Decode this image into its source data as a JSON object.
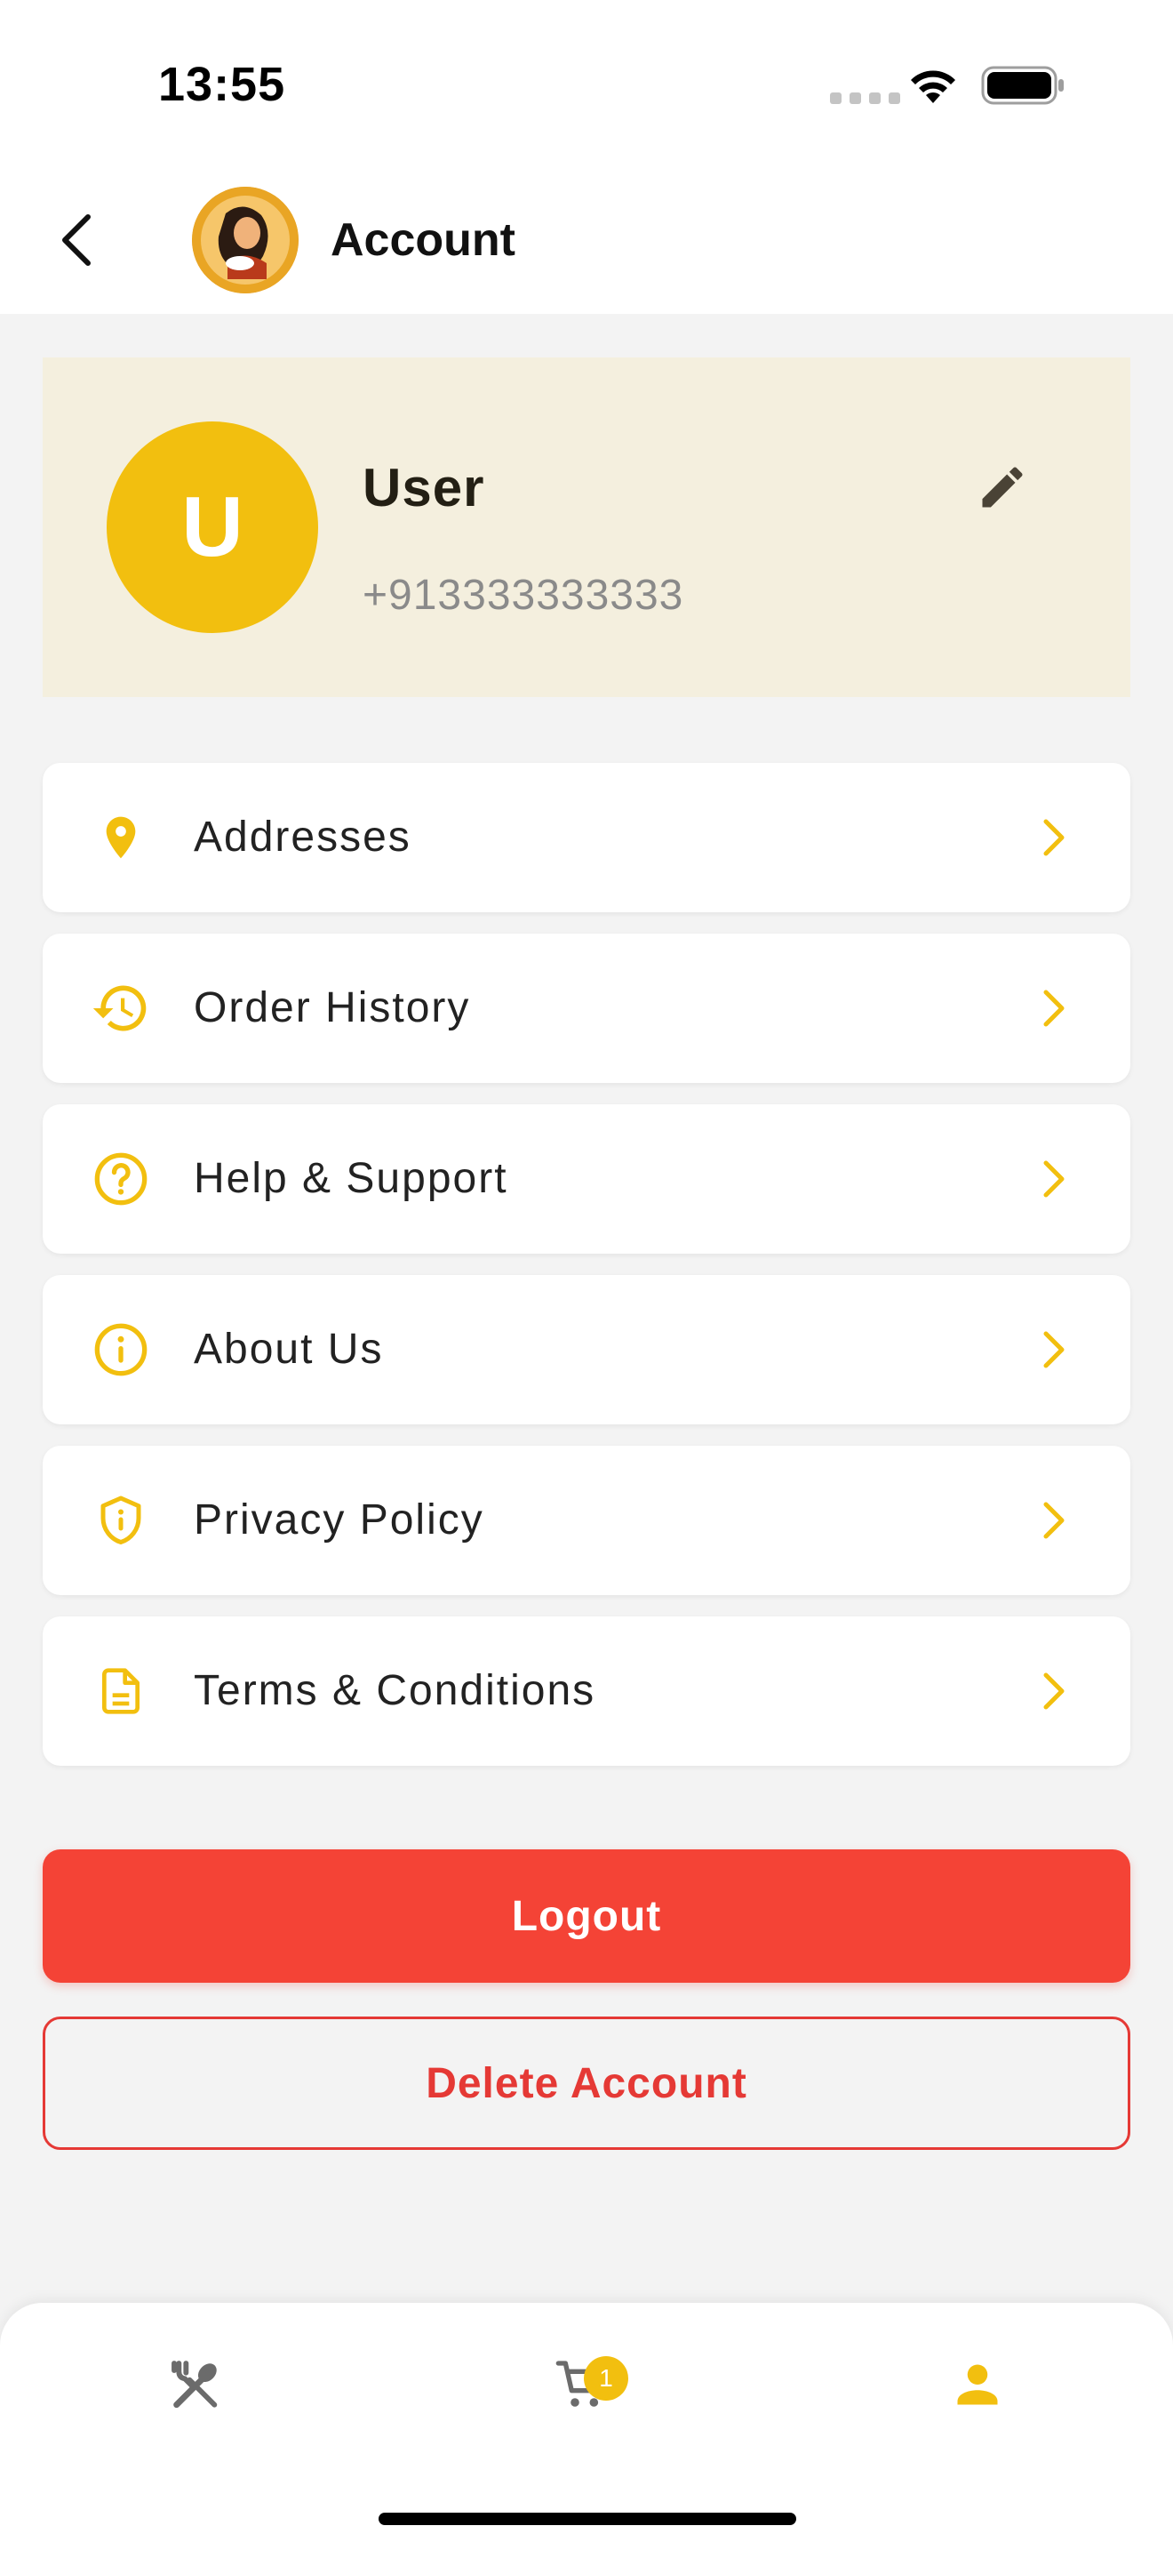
{
  "status_bar": {
    "time": "13:55"
  },
  "header": {
    "title": "Account",
    "back_icon": "chevron-left-icon",
    "logo": "brand-logo"
  },
  "profile": {
    "avatar_letter": "U",
    "name": "User",
    "phone": "+913333333333",
    "edit_icon": "pencil-icon"
  },
  "menu": [
    {
      "label": "Addresses",
      "icon": "location-pin-icon"
    },
    {
      "label": "Order History",
      "icon": "history-icon"
    },
    {
      "label": "Help & Support",
      "icon": "help-circle-icon"
    },
    {
      "label": "About Us",
      "icon": "info-circle-icon"
    },
    {
      "label": "Privacy Policy",
      "icon": "shield-info-icon"
    },
    {
      "label": "Terms & Conditions",
      "icon": "document-icon"
    }
  ],
  "actions": {
    "logout_label": "Logout",
    "delete_label": "Delete Account"
  },
  "bottom_nav": {
    "items": [
      {
        "name": "menu",
        "icon": "fork-spoon-icon",
        "active": false
      },
      {
        "name": "cart",
        "icon": "cart-icon",
        "active": false,
        "badge": "1"
      },
      {
        "name": "account",
        "icon": "person-icon",
        "active": true
      }
    ]
  },
  "colors": {
    "accent": "#f2bf0f",
    "danger": "#f44336",
    "profile_bg": "#f4efde",
    "inactive_icon": "#6b6b6b"
  }
}
